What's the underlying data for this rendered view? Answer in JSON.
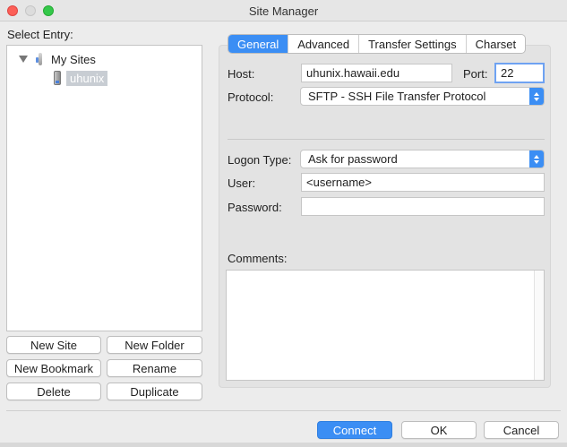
{
  "window": {
    "title": "Site Manager"
  },
  "left": {
    "label": "Select Entry:",
    "tree": {
      "root": "My Sites",
      "child": "uhunix"
    },
    "buttons": {
      "new_site": "New Site",
      "new_folder": "New Folder",
      "new_bookmark": "New Bookmark",
      "rename": "Rename",
      "delete": "Delete",
      "duplicate": "Duplicate"
    }
  },
  "tabs": [
    "General",
    "Advanced",
    "Transfer Settings",
    "Charset"
  ],
  "general": {
    "host_label": "Host:",
    "host_value": "uhunix.hawaii.edu",
    "port_label": "Port:",
    "port_value": "22",
    "protocol_label": "Protocol:",
    "protocol_value": "SFTP - SSH File Transfer Protocol",
    "logon_label": "Logon Type:",
    "logon_value": "Ask for password",
    "user_label": "User:",
    "user_value": "<username>",
    "password_label": "Password:",
    "password_value": "",
    "comments_label": "Comments:",
    "comments_value": ""
  },
  "footer": {
    "connect": "Connect",
    "ok": "OK",
    "cancel": "Cancel"
  },
  "colors": {
    "accent": "#3b8ef4"
  }
}
